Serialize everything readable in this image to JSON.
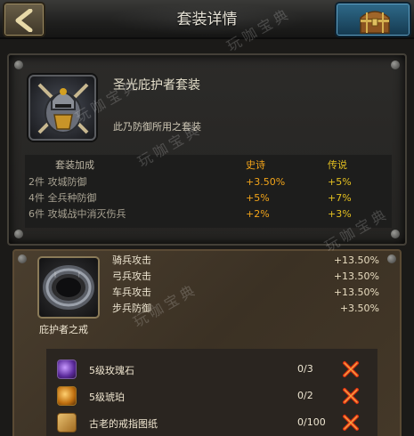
{
  "header": {
    "title": "套装详情",
    "back_icon": "back-arrow-icon",
    "chest_icon": "treasure-chest-icon"
  },
  "set": {
    "name": "圣光庇护者套装",
    "description": "此乃防御所用之套装",
    "icon": "knight-armor-icon",
    "bonus_table": {
      "headers": [
        "套装加成",
        "史诗",
        "传说"
      ],
      "rows": [
        {
          "label": "2件 攻城防御",
          "epic": "+3.50%",
          "legendary": "+5%"
        },
        {
          "label": "4件 全兵种防御",
          "epic": "+5%",
          "legendary": "+7%"
        },
        {
          "label": "6件 攻城战中消灭伤兵",
          "epic": "+2%",
          "legendary": "+3%"
        }
      ]
    }
  },
  "item": {
    "name": "庇护者之戒",
    "icon": "ring-icon",
    "stats": [
      {
        "label": "骑兵攻击",
        "value": "+13.50%"
      },
      {
        "label": "弓兵攻击",
        "value": "+13.50%"
      },
      {
        "label": "车兵攻击",
        "value": "+13.50%"
      },
      {
        "label": "步兵防御",
        "value": "+3.50%"
      }
    ],
    "materials": [
      {
        "name": "5级玫瑰石",
        "count": "0/3",
        "icon": "purple-gem-icon"
      },
      {
        "name": "5级琥珀",
        "count": "0/2",
        "icon": "amber-icon"
      },
      {
        "name": "古老的戒指图纸",
        "count": "0/100",
        "icon": "blueprint-scroll-icon"
      }
    ]
  },
  "watermark": "玩咖宝典",
  "colors": {
    "epic": "#f2a419",
    "legendary": "#e4c020",
    "missing": "#e03010"
  }
}
